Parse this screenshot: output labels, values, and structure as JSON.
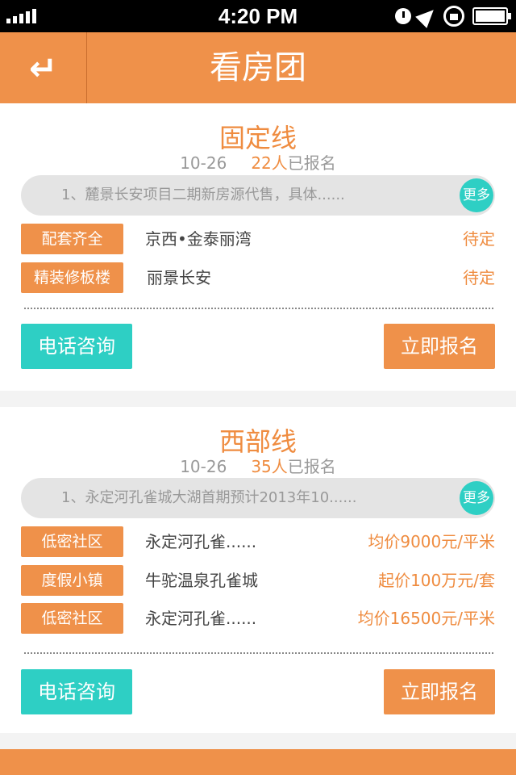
{
  "status": {
    "time": "4:20 PM"
  },
  "header": {
    "title": "看房团",
    "back_icon": "↵"
  },
  "colors": {
    "accent": "#ef914a",
    "teal": "#2ecfc4"
  },
  "groups": [
    {
      "title": "固定线",
      "date": "10-26",
      "count": "22人",
      "count_suffix": "已报名",
      "notice": "1、麓景长安项目二期新房源代售，具体......",
      "more": "更多",
      "items": [
        {
          "tag": "配套齐全",
          "name": "京西•金泰丽湾",
          "price": "待定"
        },
        {
          "tag": "精装修板楼",
          "name": "丽景长安",
          "price": "待定"
        }
      ],
      "call_label": "电话咨询",
      "join_label": "立即报名"
    },
    {
      "title": "西部线",
      "date": "10-26",
      "count": "35人",
      "count_suffix": "已报名",
      "notice": "1、永定河孔雀城大湖首期预计2013年10......",
      "more": "更多",
      "items": [
        {
          "tag": "低密社区",
          "name": "永定河孔雀......",
          "price": "均价9000元/平米"
        },
        {
          "tag": "度假小镇",
          "name": "牛驼温泉孔雀城",
          "price": "起价100万元/套"
        },
        {
          "tag": "低密社区",
          "name": "永定河孔雀......",
          "price": "均价16500元/平米"
        }
      ],
      "call_label": "电话咨询",
      "join_label": "立即报名"
    }
  ]
}
